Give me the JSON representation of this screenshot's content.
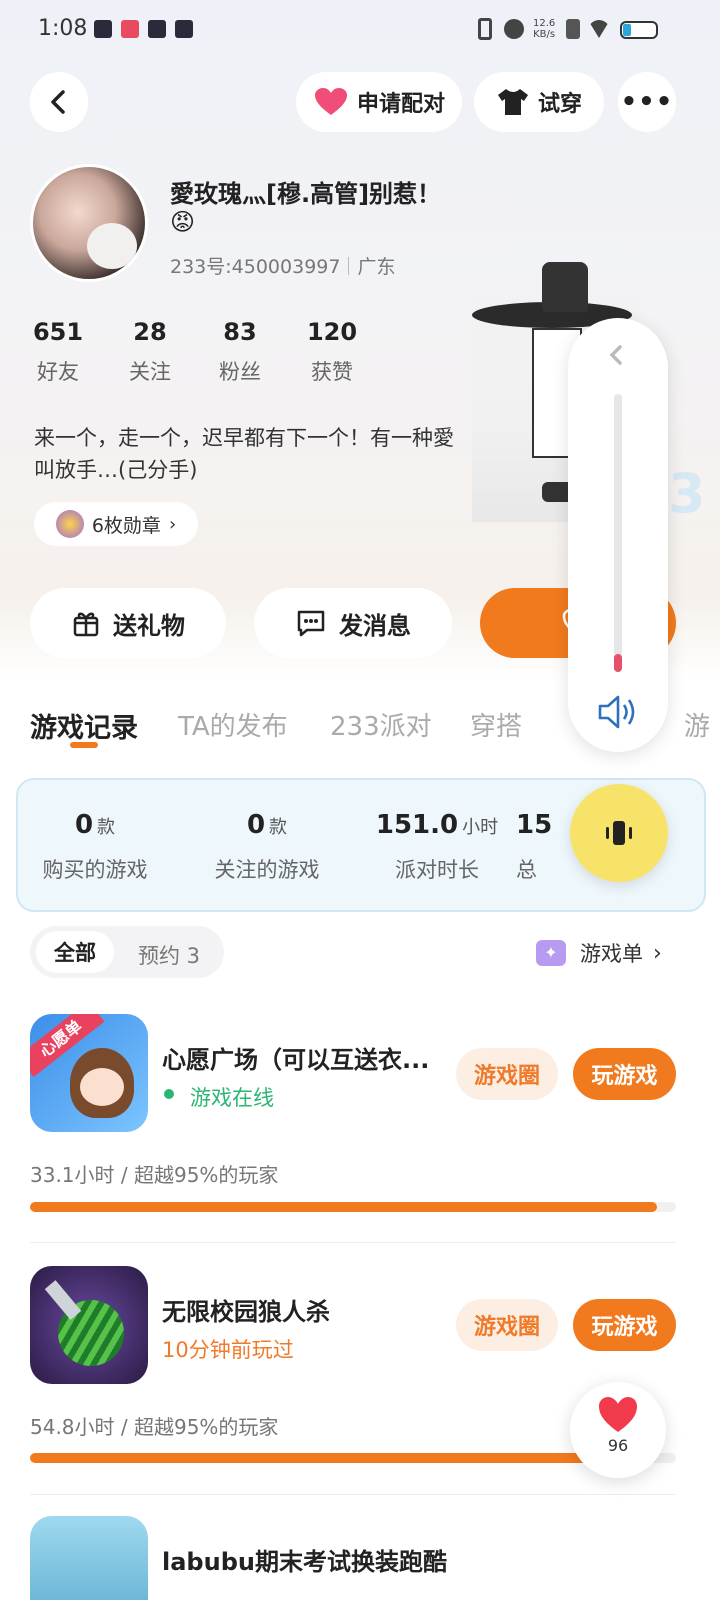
{
  "status_bar": {
    "time": "1:08",
    "net_speed_value": "12.6",
    "net_speed_unit": "KB/s"
  },
  "header": {
    "match_label": "申请配对",
    "try_on_label": "试穿"
  },
  "profile": {
    "name": "愛玫瑰灬[穆.高管]别惹！",
    "emoji": "😡",
    "id_text": "233号:450003997",
    "location": "广东",
    "bio": "来一个，走一个，迟早都有下一个！有一种愛叫放手…(己分手)",
    "badges": "6枚勋章",
    "stats": [
      {
        "value": "651",
        "label": "好友"
      },
      {
        "value": "28",
        "label": "关注"
      },
      {
        "value": "83",
        "label": "粉丝"
      },
      {
        "value": "120",
        "label": "获赞"
      }
    ]
  },
  "actions": {
    "gift": "送礼物",
    "message": "发消息"
  },
  "tabs": [
    "游戏记录",
    "TA的发布",
    "233派对",
    "穿搭",
    "游"
  ],
  "summary": [
    {
      "value": "0",
      "unit": "款",
      "label": "购买的游戏"
    },
    {
      "value": "0",
      "unit": "款",
      "label": "关注的游戏"
    },
    {
      "value": "151.0",
      "unit": "小时",
      "label": "派对时长"
    },
    {
      "value": "15",
      "unit": "",
      "label": "总"
    }
  ],
  "filter": {
    "all": "全部",
    "reserve": "预约 3",
    "game_list": "游戏单"
  },
  "games": [
    {
      "title": "心愿广场（可以互送衣...",
      "status": "游戏在线",
      "status_color": "#2bb673",
      "circle_label": "游戏圈",
      "play_label": "玩游戏",
      "meta": "33.1小时 / 超越95%的玩家",
      "progress": 0.97,
      "icon_banner": "心愿单"
    },
    {
      "title": "无限校园狼人杀",
      "status": "10分钟前玩过",
      "status_color": "#f07a2a",
      "circle_label": "游戏圈",
      "play_label": "玩游戏",
      "meta": "54.8小时 / 超越95%的玩家",
      "progress": 0.93
    },
    {
      "title": "labubu期末考试换装跑酷"
    }
  ],
  "floating": {
    "like_count": "96"
  },
  "colors": {
    "accent": "#f27a1e",
    "online": "#2bb673"
  }
}
